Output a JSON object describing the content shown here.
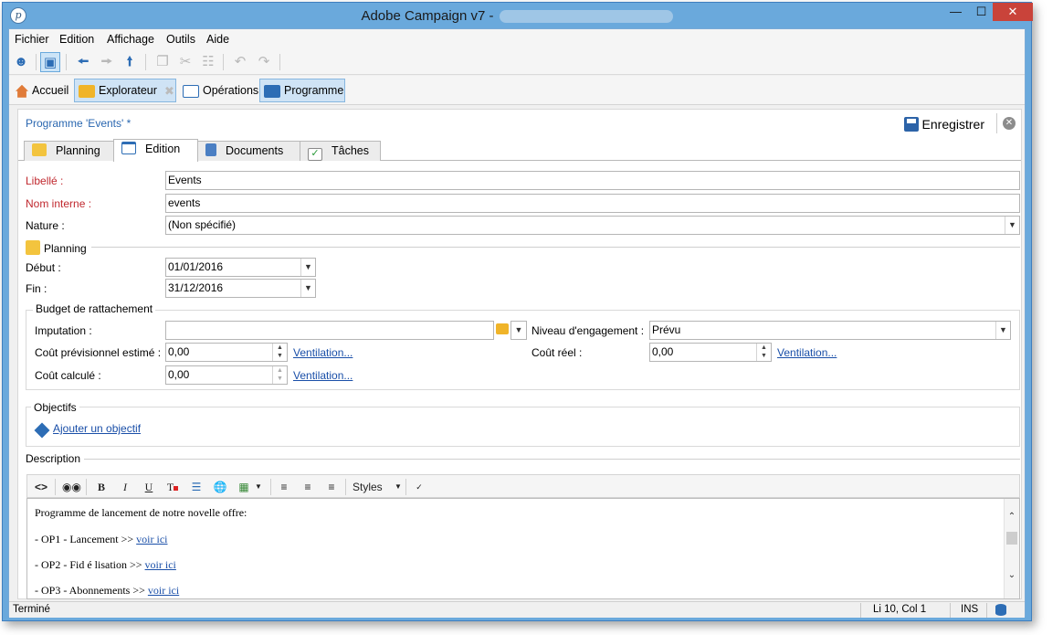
{
  "window": {
    "title": "Adobe Campaign v7 -",
    "min_glyph": "—",
    "max_glyph": "☐",
    "close_glyph": "✕"
  },
  "menu": [
    "Fichier",
    "Edition",
    "Affichage",
    "Outils",
    "Aide"
  ],
  "nav": {
    "home": "Accueil",
    "explorer": "Explorateur",
    "operations": "Opérations",
    "program": "Programme"
  },
  "form": {
    "breadcrumb": "Programme 'Events' *",
    "save_label": "Enregistrer",
    "tabs": [
      "Planning",
      "Edition",
      "Documents",
      "Tâches"
    ],
    "libelle_label": "Libellé :",
    "libelle_value": "Events",
    "internal_name_label": "Nom interne :",
    "internal_name_value": "events",
    "nature_label": "Nature :",
    "nature_value": "(Non spécifié)",
    "planning_section": "Planning",
    "start_label": "Début :",
    "start_value": "01/01/2016",
    "end_label": "Fin :",
    "end_value": "31/12/2016",
    "budget_section": "Budget de rattachement",
    "imputation_label": "Imputation :",
    "imputation_value": "",
    "engagement_label": "Niveau d'engagement :",
    "engagement_value": "Prévu",
    "estimated_cost_label": "Coût prévisionnel estimé :",
    "estimated_cost_value": "0,00",
    "real_cost_label": "Coût réel :",
    "real_cost_value": "0,00",
    "computed_cost_label": "Coût calculé :",
    "computed_cost_value": "0,00",
    "ventilation_label": "Ventilation...",
    "objectives_section": "Objectifs",
    "add_objective": "Ajouter un objectif",
    "description_section": "Description",
    "styles_label": "Styles",
    "description_lines": [
      {
        "text": "Programme de lancement de notre novelle offre:",
        "link": ""
      },
      {
        "text": "- OP1 - Lancement >> ",
        "link": "voir ici"
      },
      {
        "text": "- OP2 - Fid é lisation >> ",
        "link": "voir ici"
      },
      {
        "text": "- OP3 - Abonnements >> ",
        "link": "voir ici"
      }
    ]
  },
  "status": {
    "left": "Terminé",
    "position": "Li 10, Col 1",
    "mode": "INS"
  },
  "colors": {
    "title_bar": "#6aa9dc",
    "required_label": "#c0282e",
    "link": "#1a4fa8",
    "close_button": "#c9433a"
  }
}
